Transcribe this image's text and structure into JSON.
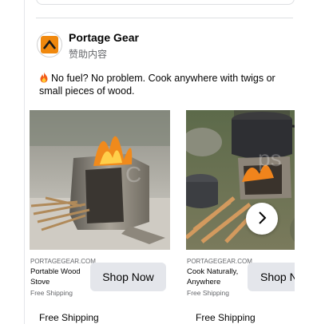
{
  "post": {
    "page_name": "Portage Gear",
    "sponsored_label": "赞助内容",
    "text": "No fuel? No problem. Cook anywhere with twigs or small pieces of wood.",
    "text_icon": "fire-emoji-icon",
    "avatar_icon": "portage-gear-logo-icon"
  },
  "carousel": {
    "cards": [
      {
        "domain": "PORTAGEGEAR.COM",
        "title": "Portable Wood Stove",
        "shipping_small": "Free Shipping",
        "cta_label": "Shop Now",
        "footer": "Free Shipping",
        "image_icon": "wood-stove-photo"
      },
      {
        "domain": "PORTAGEGEAR.COM",
        "title": "Cook Naturally, Anywhere",
        "shipping_small": "Free Shipping",
        "cta_label": "Shop N",
        "footer": "Free Shipping",
        "image_icon": "stove-with-pot-photo"
      }
    ],
    "next_icon": "chevron-right-icon"
  },
  "colors": {
    "brand_orange": "#f0880d",
    "button_gray": "#e4e6eb",
    "secondary_text": "#65676b"
  }
}
